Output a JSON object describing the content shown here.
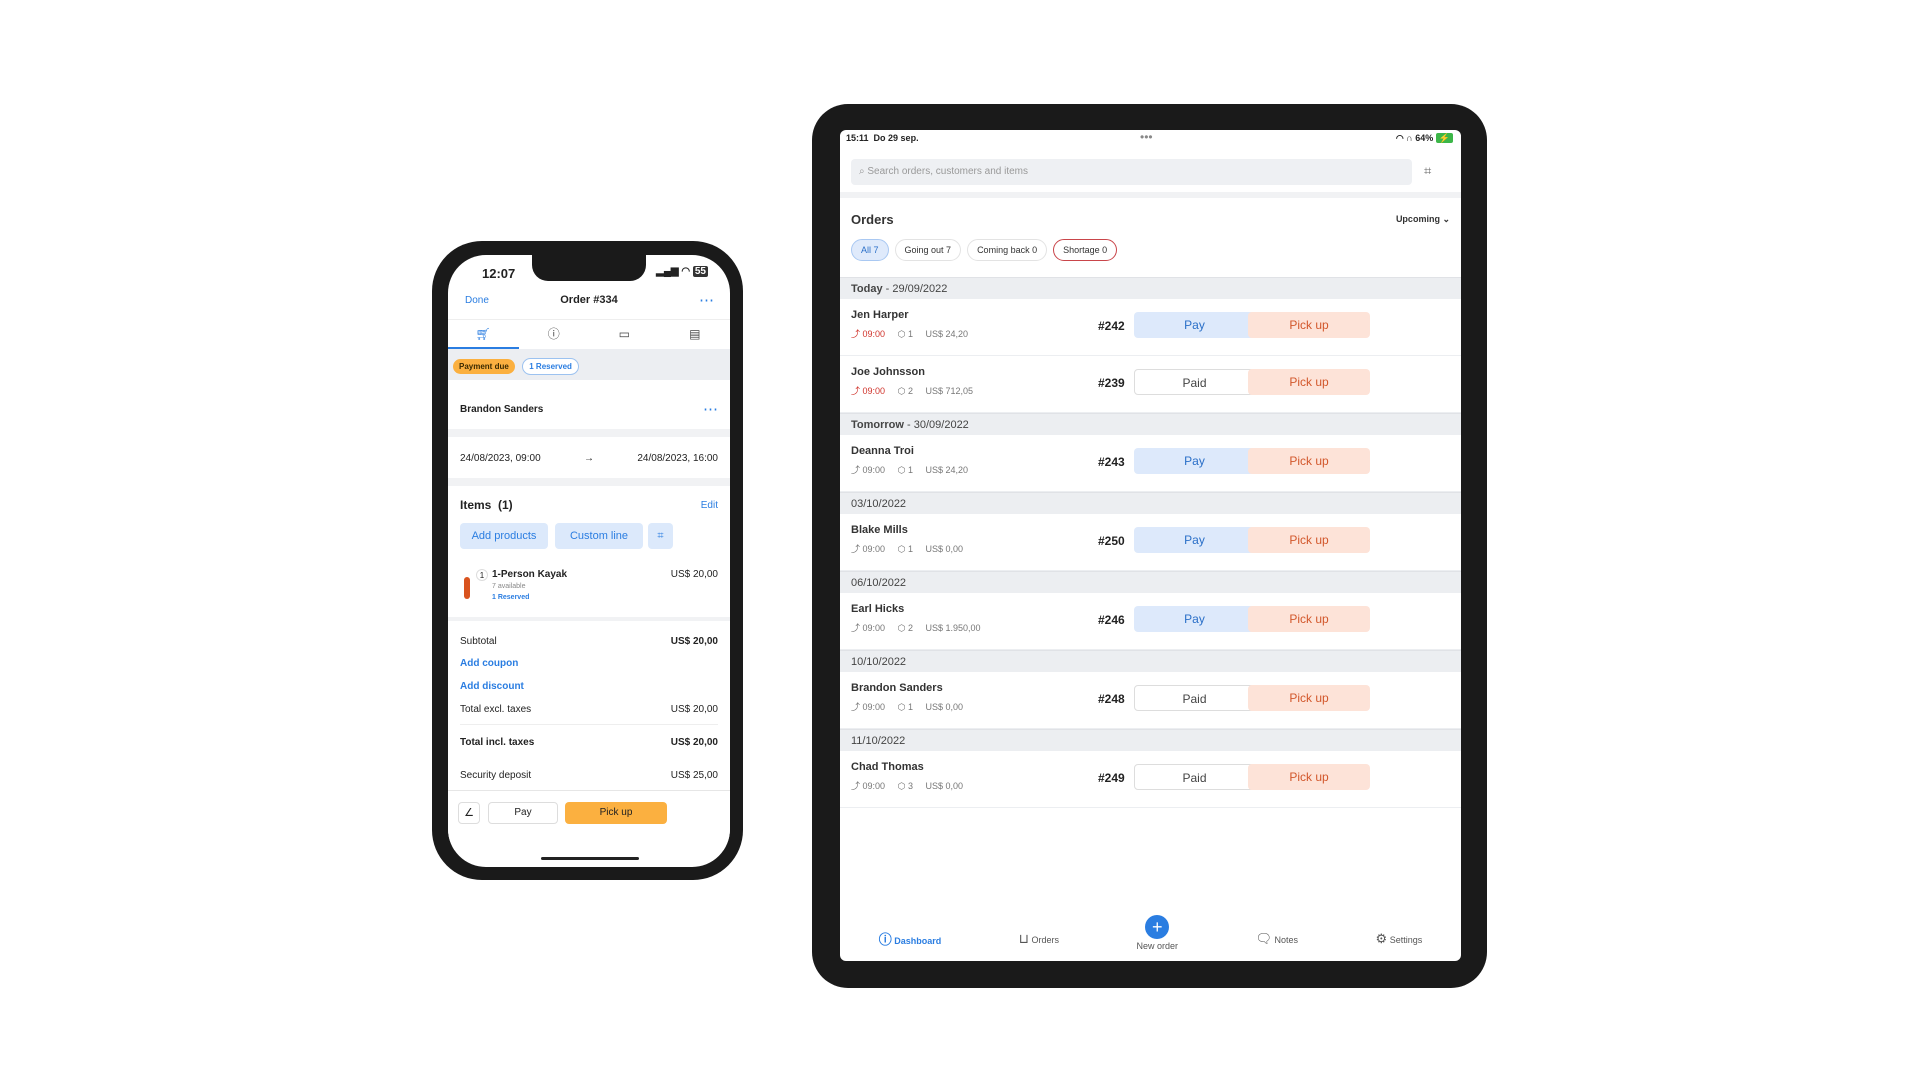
{
  "phone": {
    "status": {
      "time": "12:07",
      "battery": "55"
    },
    "nav": {
      "done": "Done",
      "title": "Order #334"
    },
    "badges": {
      "payment": "Payment due",
      "reserved": "1 Reserved"
    },
    "customer": "Brandon Sanders",
    "dates": {
      "start": "24/08/2023, 09:00",
      "arrow": "→",
      "end": "24/08/2023, 16:00"
    },
    "items": {
      "title": "Items  (1)",
      "edit": "Edit",
      "add_products": "Add products",
      "custom_line": "Custom line"
    },
    "item": {
      "qty": "1",
      "name": "1-Person Kayak",
      "available": "7 available",
      "reserved": "1 Reserved",
      "price": "US$ 20,00"
    },
    "totals": {
      "subtotal_label": "Subtotal",
      "subtotal": "US$ 20,00",
      "add_coupon": "Add coupon",
      "add_discount": "Add discount",
      "excl_label": "Total excl. taxes",
      "excl": "US$ 20,00",
      "incl_label": "Total incl. taxes",
      "incl": "US$ 20,00",
      "deposit_label": "Security deposit",
      "deposit": "US$ 25,00"
    },
    "footer": {
      "pay": "Pay",
      "pickup": "Pick up"
    }
  },
  "tablet": {
    "status": {
      "time": "15:11",
      "date": "Do 29 sep.",
      "battery": "64%"
    },
    "search_placeholder": "Search orders, customers and items",
    "orders_title": "Orders",
    "filter": "Upcoming",
    "chips": [
      "All 7",
      "Going out 7",
      "Coming back 0",
      "Shortage 0"
    ],
    "groups": [
      {
        "label": "Today",
        "date": " - 29/09/2022",
        "orders": [
          {
            "name": "Jen Harper",
            "time": "09:00",
            "late": true,
            "qty": "1",
            "amount": "US$ 24,20",
            "num": "#242",
            "pay": "Pay",
            "pickup": "Pick up"
          },
          {
            "name": "Joe Johnsson",
            "time": "09:00",
            "late": true,
            "qty": "2",
            "amount": "US$ 712,05",
            "num": "#239",
            "pay": "Paid",
            "pickup": "Pick up"
          }
        ]
      },
      {
        "label": "Tomorrow",
        "date": " - 30/09/2022",
        "orders": [
          {
            "name": "Deanna Troi",
            "time": "09:00",
            "qty": "1",
            "amount": "US$ 24,20",
            "num": "#243",
            "pay": "Pay",
            "pickup": "Pick up"
          }
        ]
      },
      {
        "label": "",
        "date": "03/10/2022",
        "orders": [
          {
            "name": "Blake Mills",
            "time": "09:00",
            "qty": "1",
            "amount": "US$ 0,00",
            "num": "#250",
            "pay": "Pay",
            "pickup": "Pick up"
          }
        ]
      },
      {
        "label": "",
        "date": "06/10/2022",
        "orders": [
          {
            "name": "Earl Hicks",
            "time": "09:00",
            "qty": "2",
            "amount": "US$ 1.950,00",
            "num": "#246",
            "pay": "Pay",
            "pickup": "Pick up"
          }
        ]
      },
      {
        "label": "",
        "date": "10/10/2022",
        "orders": [
          {
            "name": "Brandon Sanders",
            "time": "09:00",
            "qty": "1",
            "amount": "US$ 0,00",
            "num": "#248",
            "pay": "Paid",
            "pickup": "Pick up"
          }
        ]
      },
      {
        "label": "",
        "date": "11/10/2022",
        "orders": [
          {
            "name": "Chad Thomas",
            "time": "09:00",
            "qty": "3",
            "amount": "US$ 0,00",
            "num": "#249",
            "pay": "Paid",
            "pickup": "Pick up"
          }
        ]
      }
    ],
    "nav": [
      "Dashboard",
      "Orders",
      "New order",
      "Notes",
      "Settings"
    ]
  },
  "colors": {
    "accent": "#2a7de1",
    "orange": "#fbb040",
    "pickup_bg": "#fde3d8",
    "late": "#d0342c"
  }
}
